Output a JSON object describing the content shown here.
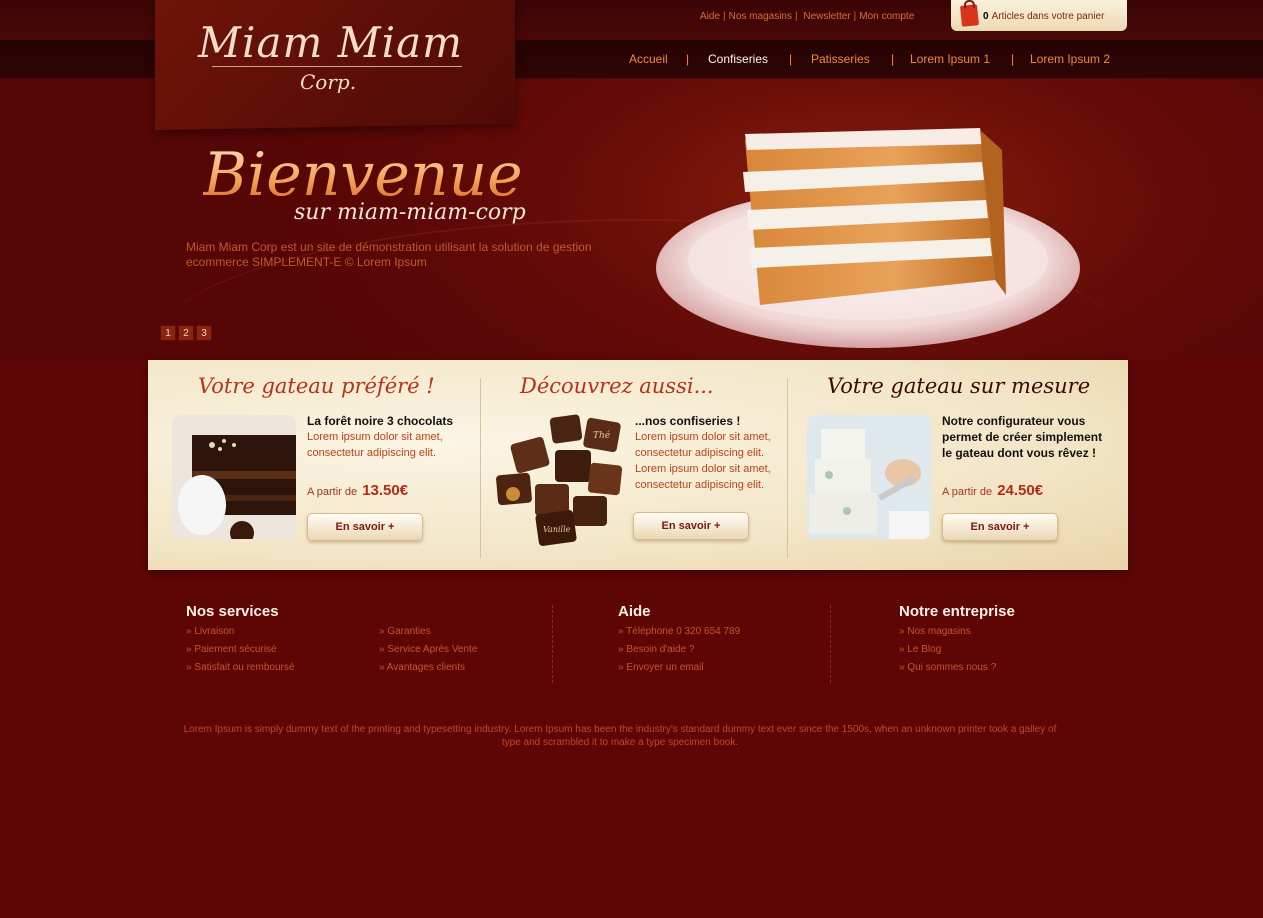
{
  "brand": {
    "title": "Miam Miam",
    "subtitle": "Corp."
  },
  "toplinks": [
    "Aide",
    "Nos magasins",
    "Newsletter",
    "Mon compte"
  ],
  "cart": {
    "count": "0",
    "label": "Articles dans votre panier"
  },
  "nav": [
    "Accueil",
    "Confiseries",
    "Patisseries",
    "Lorem Ipsum 1",
    "Lorem Ipsum 2"
  ],
  "nav_active": "Confiseries",
  "hero": {
    "title": "Bienvenue",
    "subtitle": "sur miam-miam-corp",
    "text": "Miam Miam Corp est un site de démonstration utilisant la solution de gestion ecommerce SIMPLEMENT-E © Lorem Ipsum",
    "pages": [
      "1",
      "2",
      "3"
    ]
  },
  "products": [
    {
      "heading": "Votre gateau préféré !",
      "title": "La forêt noire 3 chocolats",
      "desc": "Lorem ipsum dolor sit amet, consectetur adipiscing elit.",
      "price_label": "A partir de",
      "price": "13.50€",
      "button": "En savoir +"
    },
    {
      "heading": "Découvrez aussi...",
      "title": "...nos confiseries !",
      "desc": "Lorem ipsum dolor sit amet, consectetur adipiscing elit. Lorem ipsum dolor sit amet, consectetur adipiscing elit.",
      "button": "En savoir +",
      "image_labels": [
        "Thé",
        "Vanille"
      ]
    },
    {
      "heading": "Votre gateau sur mesure",
      "title": "Notre configurateur vous permet de créer simplement le gateau dont vous rêvez !",
      "price_label": "A partir de",
      "price": "24.50€",
      "button": "En savoir +"
    }
  ],
  "footer": {
    "services": {
      "heading": "Nos services",
      "col1": [
        "Livraison",
        "Paiement sécurisé",
        "Satisfait ou remboursé"
      ],
      "col2": [
        "Garanties",
        "Service Après Vente",
        "Avantages clients"
      ]
    },
    "aide": {
      "heading": "Aide",
      "links": [
        "Téléphone 0 320 654 789",
        "Besoin d'aide ?",
        "Envoyer un email"
      ]
    },
    "entreprise": {
      "heading": "Notre entreprise",
      "links": [
        "Nos magasins",
        "Le Blog",
        "Qui sommes nous ?"
      ]
    },
    "copyright": "Lorem Ipsum is simply dummy text of the printing and typesetting industry. Lorem Ipsum has been the industry's standard dummy text ever since the 1500s, when an unknown printer took a galley of type and scrambled it to make a type specimen book."
  },
  "colors": {
    "background": "#5e0606",
    "accent": "#f08a3a",
    "panel": "#f3e6c8",
    "price": "#b52a16"
  }
}
